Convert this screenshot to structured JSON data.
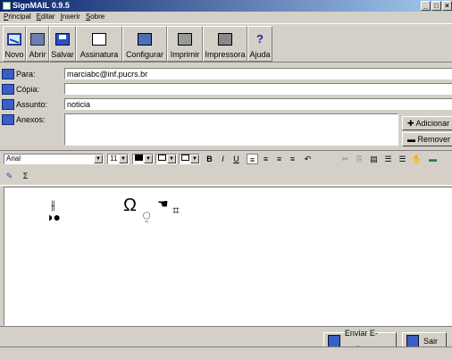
{
  "window": {
    "title": "SignMAIL 0.9.5",
    "buttons": [
      "_",
      "□",
      "×"
    ]
  },
  "menu": [
    "Principal",
    "Editar",
    "Inserir",
    "Sobre"
  ],
  "toolbar": [
    {
      "label": "Novo",
      "icon": "envelope-new-icon"
    },
    {
      "label": "Abrir",
      "icon": "folder-open-icon"
    },
    {
      "label": "Salvar",
      "icon": "floppy-disk-icon"
    },
    {
      "label": "Assinatura",
      "icon": "signature-icon"
    },
    {
      "label": "Configurar",
      "icon": "configure-icon"
    },
    {
      "label": "Imprimir",
      "icon": "printer-icon"
    },
    {
      "label": "Impressora",
      "icon": "printer-setup-icon"
    },
    {
      "label": "Ajuda",
      "icon": "help-icon"
    }
  ],
  "fields": {
    "para": {
      "label": "Para:",
      "value": "marciabc@inf.pucrs.br"
    },
    "copia": {
      "label": "Cópia:",
      "value": ""
    },
    "assunto": {
      "label": "Assunto:",
      "value": "noticia"
    },
    "anexos": {
      "label": "Anexos:"
    }
  },
  "attach_buttons": {
    "add": "Adicionar",
    "remove": "Remover"
  },
  "format": {
    "font": "Arial",
    "size": "11",
    "buttons": [
      "B",
      "I",
      "U"
    ],
    "sigma": "Σ"
  },
  "editor_signs": [
    "⫲",
    "◑●",
    "Ω",
    "⍜",
    "☚",
    "⌗"
  ],
  "bottom": {
    "send": "Enviar E-mail",
    "exit": "Sair"
  },
  "colors": {
    "titlebar_start": "#0a246a",
    "titlebar_end": "#a6caf0",
    "face": "#d4d0c8"
  }
}
